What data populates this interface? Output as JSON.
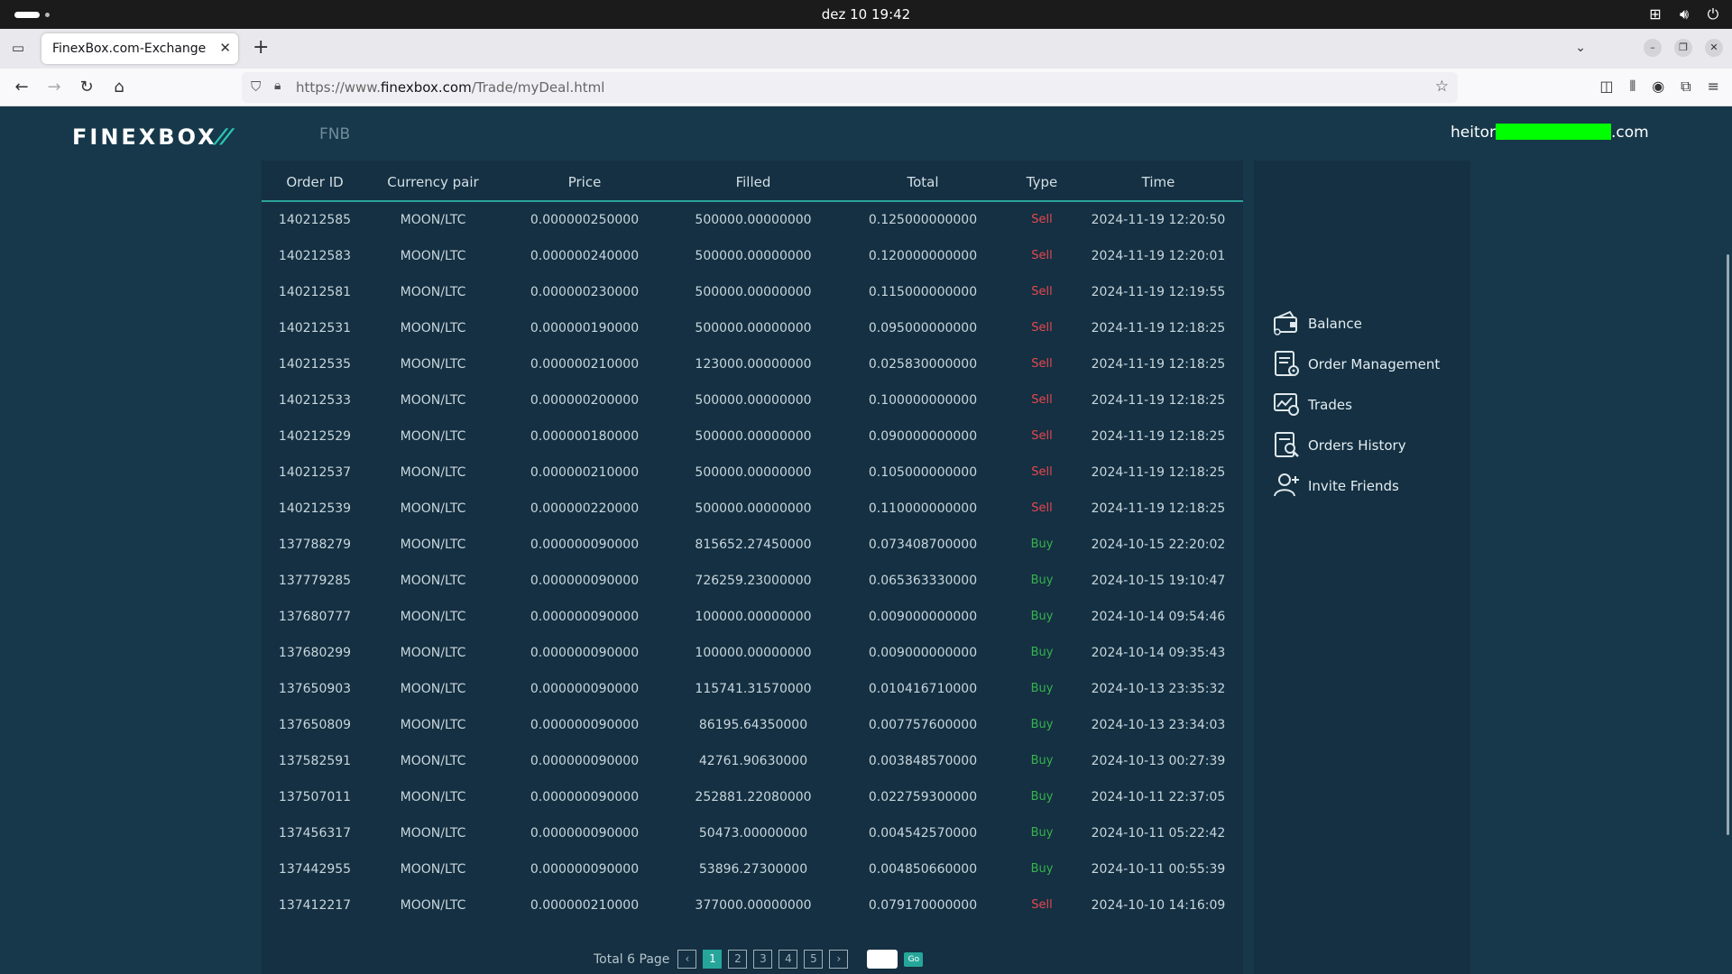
{
  "os": {
    "clock": "dez 10  19:42"
  },
  "browser": {
    "tab_title": "FinexBox.com-Exchange list",
    "url_prefix": "https://www.",
    "url_domain": "finexbox.com",
    "url_path": "/Trade/myDeal.html"
  },
  "site": {
    "logo": "FINEXBOX",
    "nav_item": "FNB",
    "user_email_prefix": "heitor",
    "user_email_suffix": ".com"
  },
  "table": {
    "headers": [
      "Order ID",
      "Currency pair",
      "Price",
      "Filled",
      "Total",
      "Type",
      "Time"
    ],
    "rows": [
      [
        "140212585",
        "MOON/LTC",
        "0.000000250000",
        "500000.00000000",
        "0.125000000000",
        "Sell",
        "2024-11-19 12:20:50"
      ],
      [
        "140212583",
        "MOON/LTC",
        "0.000000240000",
        "500000.00000000",
        "0.120000000000",
        "Sell",
        "2024-11-19 12:20:01"
      ],
      [
        "140212581",
        "MOON/LTC",
        "0.000000230000",
        "500000.00000000",
        "0.115000000000",
        "Sell",
        "2024-11-19 12:19:55"
      ],
      [
        "140212531",
        "MOON/LTC",
        "0.000000190000",
        "500000.00000000",
        "0.095000000000",
        "Sell",
        "2024-11-19 12:18:25"
      ],
      [
        "140212535",
        "MOON/LTC",
        "0.000000210000",
        "123000.00000000",
        "0.025830000000",
        "Sell",
        "2024-11-19 12:18:25"
      ],
      [
        "140212533",
        "MOON/LTC",
        "0.000000200000",
        "500000.00000000",
        "0.100000000000",
        "Sell",
        "2024-11-19 12:18:25"
      ],
      [
        "140212529",
        "MOON/LTC",
        "0.000000180000",
        "500000.00000000",
        "0.090000000000",
        "Sell",
        "2024-11-19 12:18:25"
      ],
      [
        "140212537",
        "MOON/LTC",
        "0.000000210000",
        "500000.00000000",
        "0.105000000000",
        "Sell",
        "2024-11-19 12:18:25"
      ],
      [
        "140212539",
        "MOON/LTC",
        "0.000000220000",
        "500000.00000000",
        "0.110000000000",
        "Sell",
        "2024-11-19 12:18:25"
      ],
      [
        "137788279",
        "MOON/LTC",
        "0.000000090000",
        "815652.27450000",
        "0.073408700000",
        "Buy",
        "2024-10-15 22:20:02"
      ],
      [
        "137779285",
        "MOON/LTC",
        "0.000000090000",
        "726259.23000000",
        "0.065363330000",
        "Buy",
        "2024-10-15 19:10:47"
      ],
      [
        "137680777",
        "MOON/LTC",
        "0.000000090000",
        "100000.00000000",
        "0.009000000000",
        "Buy",
        "2024-10-14 09:54:46"
      ],
      [
        "137680299",
        "MOON/LTC",
        "0.000000090000",
        "100000.00000000",
        "0.009000000000",
        "Buy",
        "2024-10-14 09:35:43"
      ],
      [
        "137650903",
        "MOON/LTC",
        "0.000000090000",
        "115741.31570000",
        "0.010416710000",
        "Buy",
        "2024-10-13 23:35:32"
      ],
      [
        "137650809",
        "MOON/LTC",
        "0.000000090000",
        "86195.64350000",
        "0.007757600000",
        "Buy",
        "2024-10-13 23:34:03"
      ],
      [
        "137582591",
        "MOON/LTC",
        "0.000000090000",
        "42761.90630000",
        "0.003848570000",
        "Buy",
        "2024-10-13 00:27:39"
      ],
      [
        "137507011",
        "MOON/LTC",
        "0.000000090000",
        "252881.22080000",
        "0.022759300000",
        "Buy",
        "2024-10-11 22:37:05"
      ],
      [
        "137456317",
        "MOON/LTC",
        "0.000000090000",
        "50473.00000000",
        "0.004542570000",
        "Buy",
        "2024-10-11 05:22:42"
      ],
      [
        "137442955",
        "MOON/LTC",
        "0.000000090000",
        "53896.27300000",
        "0.004850660000",
        "Buy",
        "2024-10-11 00:55:39"
      ],
      [
        "137412217",
        "MOON/LTC",
        "0.000000210000",
        "377000.00000000",
        "0.079170000000",
        "Sell",
        "2024-10-10 14:16:09"
      ]
    ]
  },
  "pagination": {
    "total_text": "Total 6 Page",
    "pages": [
      "1",
      "2",
      "3",
      "4",
      "5"
    ],
    "current": "1",
    "go_label": "Go"
  },
  "side_menu": {
    "items": [
      {
        "label": "Balance",
        "icon": "wallet-icon"
      },
      {
        "label": "Order Management",
        "icon": "order-settings-icon"
      },
      {
        "label": "Trades",
        "icon": "trades-chart-icon"
      },
      {
        "label": "Orders History",
        "icon": "history-search-icon"
      },
      {
        "label": "Invite Friends",
        "icon": "invite-user-icon"
      }
    ]
  },
  "colors": {
    "background": "#16384a",
    "panel": "#143042",
    "accent": "#26a69a",
    "sell": "#e8464e",
    "buy": "#37b24d",
    "redaction": "#00ff00"
  }
}
